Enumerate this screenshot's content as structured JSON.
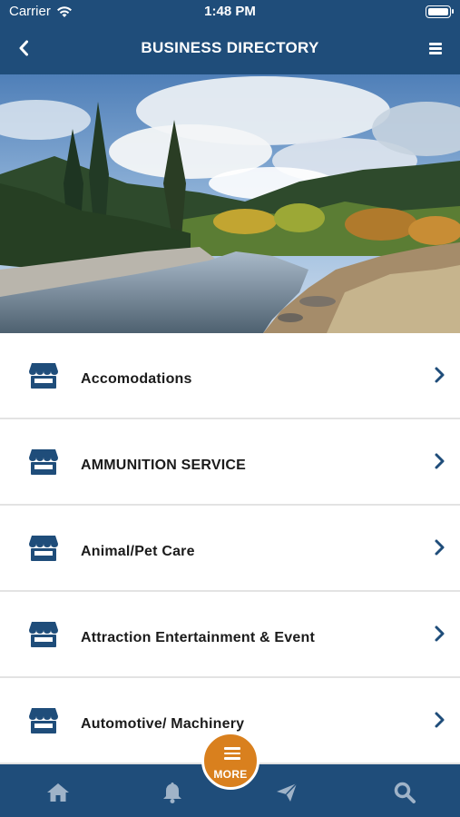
{
  "status_bar": {
    "carrier": "Carrier",
    "time": "1:48 PM"
  },
  "nav": {
    "title": "BUSINESS DIRECTORY",
    "back_icon": "chevron-left-icon",
    "menu_icon": "hamburger-icon"
  },
  "hero": {
    "image_icon": "landscape-photo"
  },
  "categories": [
    {
      "label": "Accomodations"
    },
    {
      "label": "AMMUNITION SERVICE"
    },
    {
      "label": "Animal/Pet Care"
    },
    {
      "label": "Attraction Entertainment & Event"
    },
    {
      "label": "Automotive/ Machinery"
    }
  ],
  "tab_bar": {
    "items": [
      {
        "icon": "home-icon"
      },
      {
        "icon": "bell-icon"
      },
      {
        "icon": "send-icon"
      },
      {
        "icon": "search-icon"
      }
    ],
    "more_label": "MORE"
  },
  "colors": {
    "primary": "#1f4d7a",
    "accent": "#d9801e",
    "icon": "#1f4d7a"
  }
}
